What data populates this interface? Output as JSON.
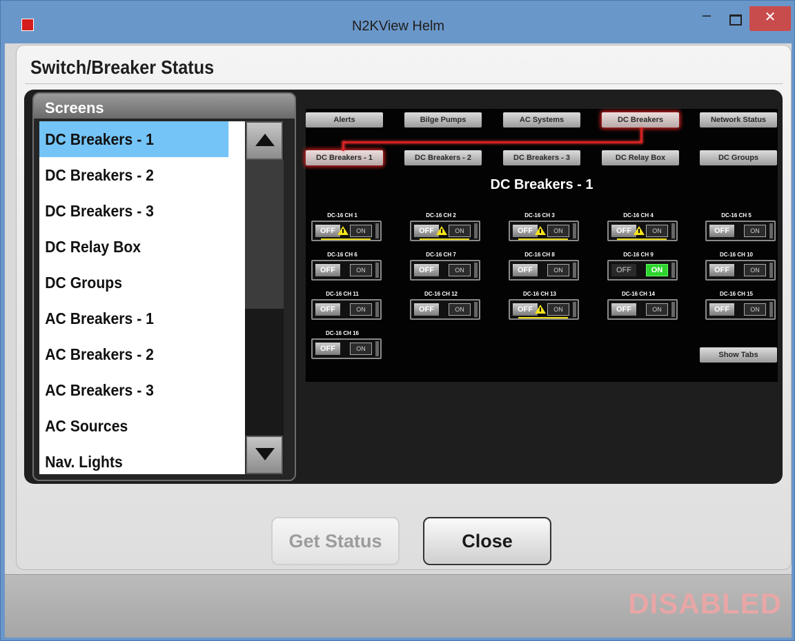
{
  "window": {
    "title": "N2KView Helm",
    "app_icon": "N2K",
    "minimize": "–",
    "close": "✕"
  },
  "panel_title": "Switch/Breaker Status",
  "screens": {
    "header": "Screens",
    "items": [
      "DC Breakers - 1",
      "DC Breakers - 2",
      "DC Breakers - 3",
      "DC Relay Box",
      "DC Groups",
      "AC Breakers - 1",
      "AC Breakers - 2",
      "AC Breakers - 3",
      "AC Sources",
      "Nav. Lights"
    ],
    "selected": "DC Breakers - 1"
  },
  "screen": {
    "nav_tabs": [
      "Alerts",
      "Bilge Pumps",
      "AC Systems",
      "DC Breakers",
      "Network Status"
    ],
    "sub_tabs": [
      "DC Breakers - 1",
      "DC Breakers - 2",
      "DC Breakers - 3",
      "DC Relay Box",
      "DC Groups"
    ],
    "title": "DC Breakers - 1",
    "off_label": "OFF",
    "on_label": "ON",
    "show_tabs": "Show Tabs",
    "channels": [
      {
        "label": "DC-16 CH 1",
        "state": "off",
        "warning": true
      },
      {
        "label": "DC-16 CH 2",
        "state": "off",
        "warning": true
      },
      {
        "label": "DC-16 CH 3",
        "state": "off",
        "warning": true
      },
      {
        "label": "DC-16 CH 4",
        "state": "off",
        "warning": true
      },
      {
        "label": "DC-16 CH 5",
        "state": "off",
        "warning": false
      },
      {
        "label": "DC-16 CH 6",
        "state": "off",
        "warning": false
      },
      {
        "label": "DC-16 CH 7",
        "state": "off",
        "warning": false
      },
      {
        "label": "DC-16 CH 8",
        "state": "off",
        "warning": false
      },
      {
        "label": "DC-16 CH 9",
        "state": "on",
        "warning": false
      },
      {
        "label": "DC-16 CH 10",
        "state": "off",
        "warning": false
      },
      {
        "label": "DC-16 CH 11",
        "state": "off",
        "warning": false
      },
      {
        "label": "DC-16 CH 12",
        "state": "off",
        "warning": false
      },
      {
        "label": "DC-16 CH 13",
        "state": "off",
        "warning": true
      },
      {
        "label": "DC-16 CH 14",
        "state": "off",
        "warning": false
      },
      {
        "label": "DC-16 CH 15",
        "state": "off",
        "warning": false
      },
      {
        "label": "DC-16 CH 16",
        "state": "off",
        "warning": false
      }
    ]
  },
  "buttons": {
    "get_status": "Get Status",
    "close": "Close"
  },
  "status_text": "DISABLED",
  "colors": {
    "selection": "#75c4f7",
    "accent_red": "#d42121",
    "on_green": "#2fd42f",
    "warning": "#f5e31a"
  }
}
